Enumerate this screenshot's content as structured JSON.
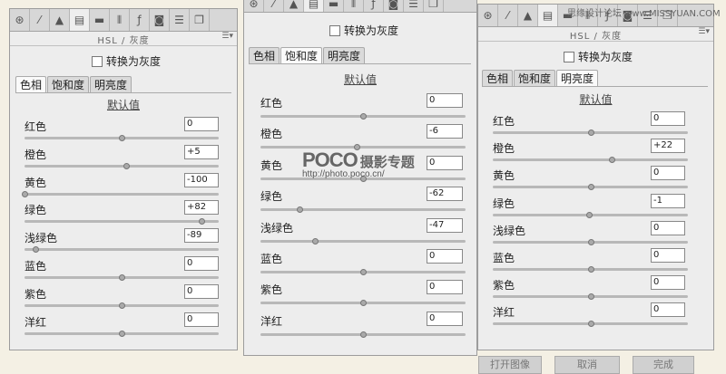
{
  "toolbar_icons": [
    "aperture-icon",
    "curve-icon",
    "triangle-icon",
    "hsl-icon",
    "split-toning-icon",
    "lens-icon",
    "fx-icon",
    "camera-icon",
    "presets-icon",
    "snapshot-icon"
  ],
  "panels": [
    {
      "title": "HSL / 灰度",
      "grayscale_label": "转换为灰度",
      "tabs": [
        "色相",
        "饱和度",
        "明亮度"
      ],
      "active_tab": 0,
      "default_label": "默认值",
      "sliders": [
        {
          "label": "红色",
          "value": "0",
          "fraction": 0.5
        },
        {
          "label": "橙色",
          "value": "+5",
          "fraction": 0.525
        },
        {
          "label": "黄色",
          "value": "-100",
          "fraction": 0.0
        },
        {
          "label": "绿色",
          "value": "+82",
          "fraction": 0.91
        },
        {
          "label": "浅绿色",
          "value": "-89",
          "fraction": 0.055
        },
        {
          "label": "蓝色",
          "value": "0",
          "fraction": 0.5
        },
        {
          "label": "紫色",
          "value": "0",
          "fraction": 0.5
        },
        {
          "label": "洋红",
          "value": "0",
          "fraction": 0.5
        }
      ]
    },
    {
      "title": "",
      "grayscale_label": "转换为灰度",
      "tabs": [
        "色相",
        "饱和度",
        "明亮度"
      ],
      "active_tab": 1,
      "default_label": "默认值",
      "sliders": [
        {
          "label": "红色",
          "value": "0",
          "fraction": 0.5
        },
        {
          "label": "橙色",
          "value": "-6",
          "fraction": 0.47
        },
        {
          "label": "黄色",
          "value": "0",
          "fraction": 0.5
        },
        {
          "label": "绿色",
          "value": "-62",
          "fraction": 0.19
        },
        {
          "label": "浅绿色",
          "value": "-47",
          "fraction": 0.265
        },
        {
          "label": "蓝色",
          "value": "0",
          "fraction": 0.5
        },
        {
          "label": "紫色",
          "value": "0",
          "fraction": 0.5
        },
        {
          "label": "洋红",
          "value": "0",
          "fraction": 0.5
        }
      ]
    },
    {
      "title": "HSL / 灰度",
      "grayscale_label": "转换为灰度",
      "tabs": [
        "色相",
        "饱和度",
        "明亮度"
      ],
      "active_tab": 2,
      "default_label": "默认值",
      "sliders": [
        {
          "label": "红色",
          "value": "0",
          "fraction": 0.5
        },
        {
          "label": "橙色",
          "value": "+22",
          "fraction": 0.61
        },
        {
          "label": "黄色",
          "value": "0",
          "fraction": 0.5
        },
        {
          "label": "绿色",
          "value": "-1",
          "fraction": 0.495
        },
        {
          "label": "浅绿色",
          "value": "0",
          "fraction": 0.5
        },
        {
          "label": "蓝色",
          "value": "0",
          "fraction": 0.5
        },
        {
          "label": "紫色",
          "value": "0",
          "fraction": 0.5
        },
        {
          "label": "洋红",
          "value": "0",
          "fraction": 0.5
        }
      ]
    }
  ],
  "watermark_text": "思缘设计论坛 www.MISSYUAN.COM",
  "poco_brand": "POCO",
  "poco_title": "摄影专题",
  "poco_url": "http://photo.poco.cn/",
  "footer_buttons": [
    "打开图像",
    "取消",
    "完成"
  ]
}
